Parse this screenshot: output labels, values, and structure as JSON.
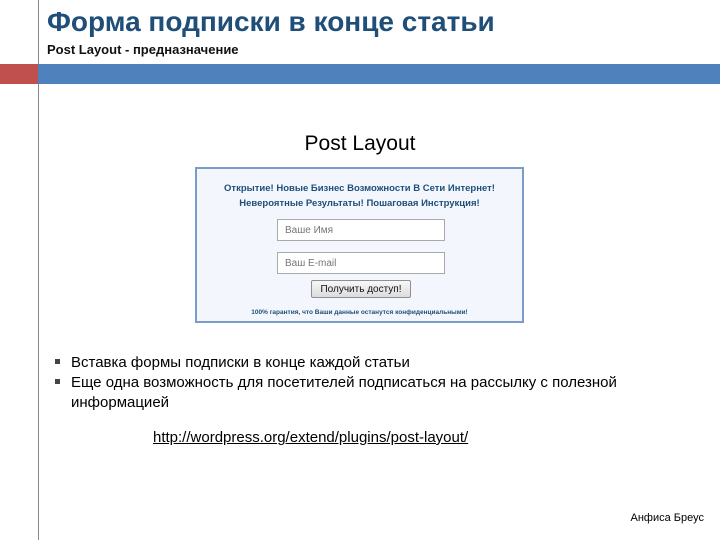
{
  "slide": {
    "title": "Форма подписки в конце статьи",
    "subtitle": "Post Layout - предназначение",
    "figure_caption": "Post Layout",
    "colors": {
      "title": "#1f4e79",
      "accent_red": "#c0504d",
      "accent_blue": "#4f81bd"
    }
  },
  "form": {
    "headline_line1": "Открытие! Новые Бизнес Возможности В Сети Интернет!",
    "headline_line2": "Невероятные Результаты! Пошаговая Инструкция!",
    "name_placeholder": "Ваше Имя",
    "email_placeholder": "Ваш E-mail",
    "submit_label": "Получить доступ!",
    "guarantee": "100% гарантия, что Ваши данные останутся конфиденциальными!"
  },
  "bullets": [
    "Вставка формы подписки в конце каждой статьи",
    "Еще одна возможность для посетителей подписаться на рассылку с полезной информацией"
  ],
  "link_text": "http://wordpress.org/extend/plugins/post-layout/",
  "author": "Анфиса Бреус"
}
